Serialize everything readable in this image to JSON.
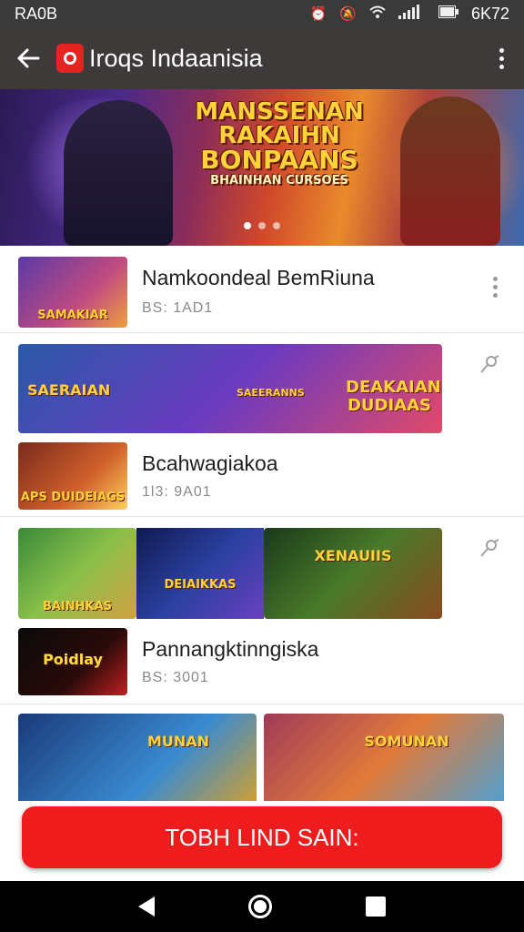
{
  "status_bar": {
    "left_text": "RA0B",
    "right_text": "6K72",
    "icons": [
      "alarm-icon",
      "mute-icon",
      "wifi-icon",
      "signal-icon",
      "battery-icon"
    ]
  },
  "app_bar": {
    "title": "Iroqs Indaanisia",
    "back_icon": "arrow-left-icon",
    "more_icon": "more-vertical-icon"
  },
  "hero": {
    "title_lines": [
      "MANSSENAN",
      "RAKAIHN",
      "BONPAANS",
      "BHAINHAN CURSOES"
    ],
    "page_count": 3,
    "active_page": 0
  },
  "list": {
    "items": [
      {
        "title": "Namkoondeal BemRiuna",
        "subtitle": "BS: 1AD1",
        "thumb_labels": [
          "SAMAKIAR"
        ],
        "action_icon": "more-vertical-icon"
      },
      {
        "title": "Bcahwagiakoa",
        "subtitle": "1l3: 9A01",
        "banner_labels": [
          "SAERAIAN",
          "SAEERANNS",
          "DEAKAIAN DUDIAAS"
        ],
        "thumb_labels": [
          "APS DUIDEIAGS"
        ],
        "action_icon": "pin-icon"
      },
      {
        "title": "Pannangktinngiska",
        "subtitle": "BS: 3001",
        "banner_labels": [
          "BAINHKAS",
          "DEIAIKKAS",
          "XENAUIIS"
        ],
        "thumb_labels": [
          "Poidlay"
        ],
        "action_icon": "pin-icon"
      },
      {
        "banner_labels": [
          "MUNAN",
          "SOMUNAN"
        ]
      }
    ]
  },
  "cta": {
    "label": "TOBH LIND SAIN:"
  },
  "nav_bar": {
    "icons": [
      "back-triangle-icon",
      "home-circle-icon",
      "recents-square-icon"
    ]
  }
}
